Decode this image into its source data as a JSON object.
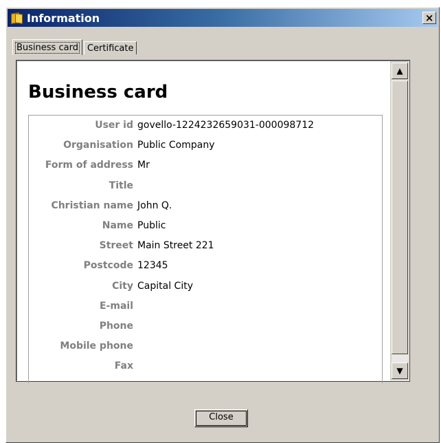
{
  "window": {
    "title": "Information",
    "close_label": "×"
  },
  "tabs": [
    {
      "label": "Business card",
      "active": true
    },
    {
      "label": "Certificate",
      "active": false
    }
  ],
  "card": {
    "heading": "Business card",
    "fields": [
      {
        "label": "User id",
        "value": "govello-1224232659031-000098712"
      },
      {
        "label": "Organisation",
        "value": "Public Company"
      },
      {
        "label": "Form of address",
        "value": "Mr"
      },
      {
        "label": "Title",
        "value": ""
      },
      {
        "label": "Christian name",
        "value": "John Q."
      },
      {
        "label": "Name",
        "value": "Public"
      },
      {
        "label": "Street",
        "value": "Main Street 221"
      },
      {
        "label": "Postcode",
        "value": "12345"
      },
      {
        "label": "City",
        "value": "Capital City"
      },
      {
        "label": "E-mail",
        "value": ""
      },
      {
        "label": "Phone",
        "value": ""
      },
      {
        "label": "Mobile phone",
        "value": ""
      },
      {
        "label": "Fax",
        "value": ""
      }
    ]
  },
  "scrollbar": {
    "up_arrow": "▲",
    "down_arrow": "▼"
  },
  "footer": {
    "close_button": "Close"
  },
  "colors": {
    "titlebar_start": "#0a246a",
    "titlebar_end": "#a6caf0",
    "dialog_bg": "#d4d0c8",
    "label_gray": "#808080"
  },
  "icons": {
    "app": "book-icon",
    "close": "close-icon"
  }
}
